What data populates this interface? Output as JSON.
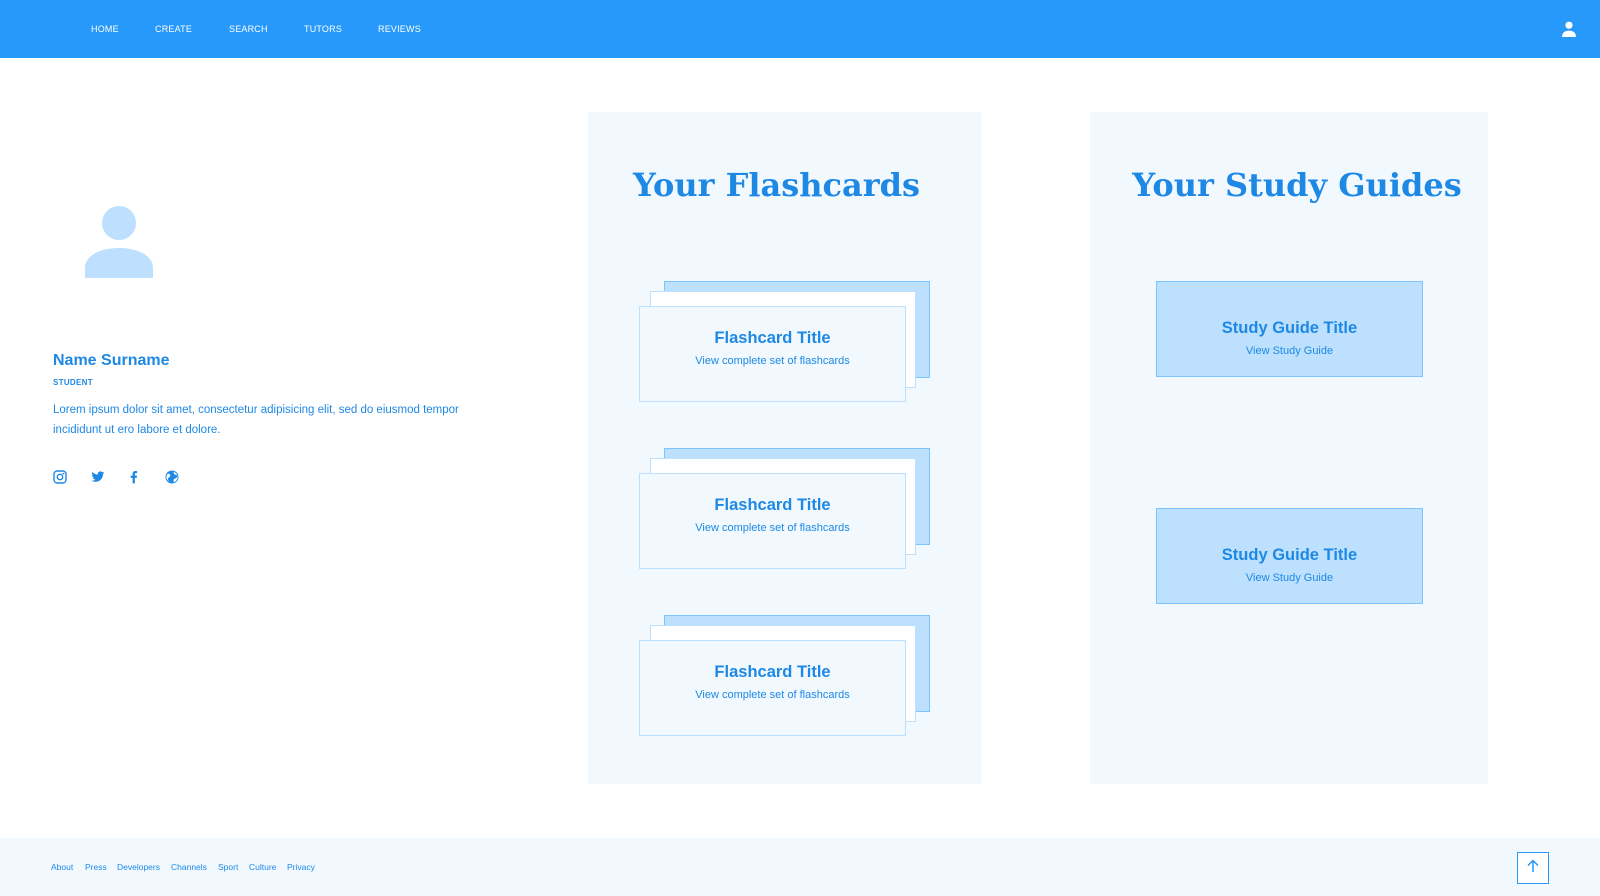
{
  "nav": {
    "items": [
      {
        "label": "HOME"
      },
      {
        "label": "CREATE"
      },
      {
        "label": "SEARCH"
      },
      {
        "label": "TUTORS"
      },
      {
        "label": "REVIEWS"
      }
    ],
    "user_icon": "user-icon"
  },
  "profile": {
    "avatar_icon": "person-icon",
    "name": "Name Surname",
    "role": "STUDENT",
    "bio": "Lorem ipsum dolor sit amet, consectetur adipisicing elit, sed do eiusmod tempor incididunt ut ero labore et dolore.",
    "socials": [
      {
        "icon": "instagram-icon"
      },
      {
        "icon": "twitter-icon"
      },
      {
        "icon": "facebook-icon"
      },
      {
        "icon": "globe-icon"
      }
    ]
  },
  "flashcards": {
    "title": "Your Flashcards",
    "items": [
      {
        "title": "Flashcard Title",
        "link": "View complete set of flashcards"
      },
      {
        "title": "Flashcard Title",
        "link": "View complete set of flashcards"
      },
      {
        "title": "Flashcard Title",
        "link": "View complete set of flashcards"
      }
    ]
  },
  "study_guides": {
    "title": "Your Study Guides",
    "items": [
      {
        "title": "Study Guide Title",
        "link": "View Study Guide"
      },
      {
        "title": "Study Guide Title",
        "link": "View Study Guide"
      }
    ]
  },
  "footer": {
    "links": [
      {
        "label": "About"
      },
      {
        "label": "Press"
      },
      {
        "label": "Developers"
      },
      {
        "label": "Channels"
      },
      {
        "label": "Sport"
      },
      {
        "label": "Culture"
      },
      {
        "label": "Privacy"
      }
    ],
    "top_icon": "arrow-up-icon"
  },
  "colors": {
    "primary": "#2699fb",
    "text": "#1e88e5",
    "light_blue": "#bce0fd",
    "panel_bg": "#f1f9ff"
  }
}
